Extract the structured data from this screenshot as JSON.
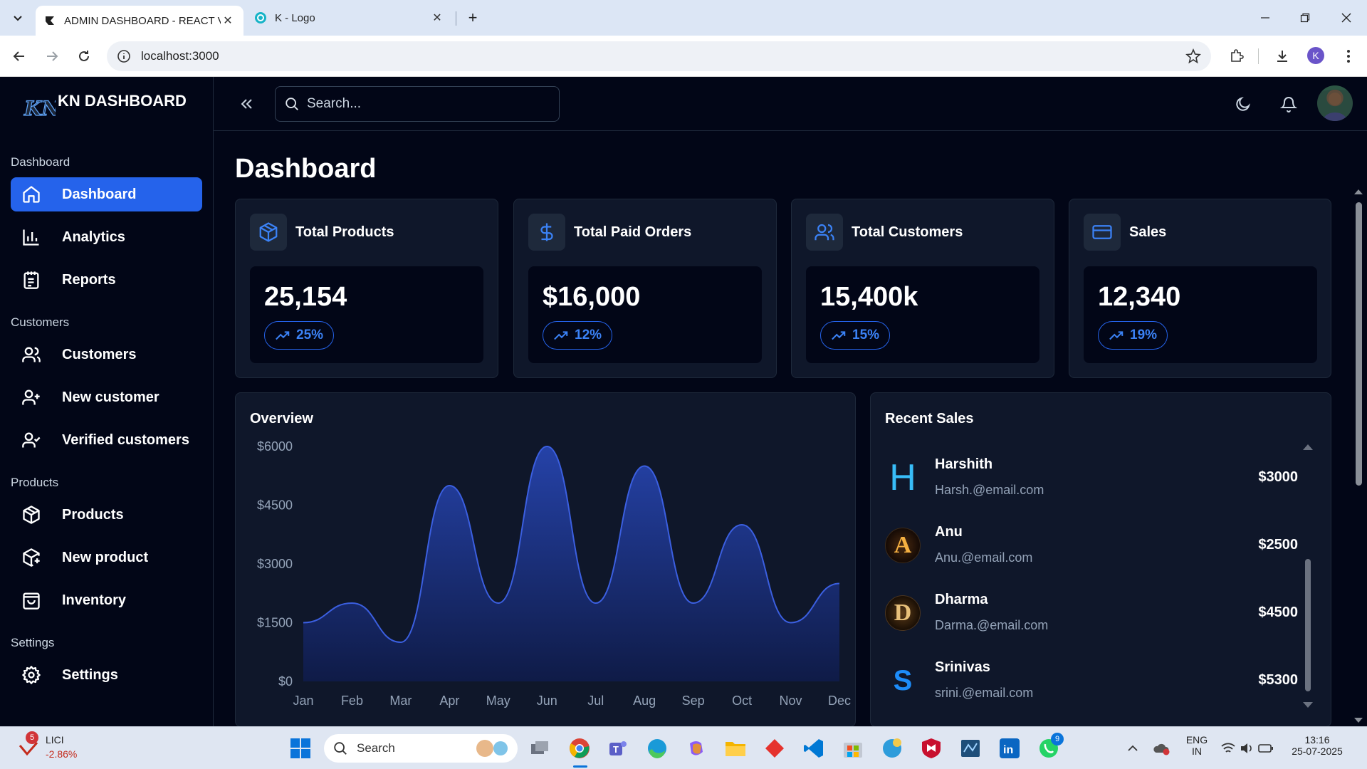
{
  "browser": {
    "tabs": [
      {
        "title": "ADMIN DASHBOARD - REACT V",
        "active": true
      },
      {
        "title": "K - Logo",
        "active": false
      }
    ],
    "new_tab": "+",
    "close": "✕",
    "url": "localhost:3000",
    "profile_initial": "K"
  },
  "app": {
    "brand": "KN DASHBOARD",
    "brand_logo_text": "KN",
    "search_placeholder": "Search...",
    "page_title": "Dashboard"
  },
  "sidebar": {
    "sections": [
      {
        "label": "Dashboard"
      },
      {
        "label": "Customers"
      },
      {
        "label": "Products"
      },
      {
        "label": "Settings"
      }
    ],
    "items": [
      {
        "label": "Dashboard",
        "icon": "home-icon",
        "active": true
      },
      {
        "label": "Analytics",
        "icon": "bar-chart-icon"
      },
      {
        "label": "Reports",
        "icon": "notepad-icon"
      },
      {
        "label": "Customers",
        "icon": "users-icon"
      },
      {
        "label": "New customer",
        "icon": "user-plus-icon"
      },
      {
        "label": "Verified customers",
        "icon": "user-check-icon"
      },
      {
        "label": "Products",
        "icon": "package-icon"
      },
      {
        "label": "New product",
        "icon": "package-plus-icon"
      },
      {
        "label": "Inventory",
        "icon": "shopping-bag-icon"
      },
      {
        "label": "Settings",
        "icon": "gear-icon"
      }
    ]
  },
  "cards": [
    {
      "title": "Total Products",
      "value": "25,154",
      "change": "25%",
      "icon": "package-icon"
    },
    {
      "title": "Total Paid Orders",
      "value": "$16,000",
      "change": "12%",
      "icon": "dollar-icon"
    },
    {
      "title": "Total Customers",
      "value": "15,400k",
      "change": "15%",
      "icon": "users-icon"
    },
    {
      "title": "Sales",
      "value": "12,340",
      "change": "19%",
      "icon": "credit-card-icon"
    }
  ],
  "overview": {
    "title": "Overview"
  },
  "recent_sales": {
    "title": "Recent Sales",
    "rows": [
      {
        "name": "Harshith",
        "email": "Harsh.@email.com",
        "amount": "$3000",
        "avatar_letter": "H"
      },
      {
        "name": "Anu",
        "email": "Anu.@email.com",
        "amount": "$2500",
        "avatar_letter": "A"
      },
      {
        "name": "Dharma",
        "email": "Darma.@email.com",
        "amount": "$4500",
        "avatar_letter": "D"
      },
      {
        "name": "Srinivas",
        "email": "srini.@email.com",
        "amount": "$5300",
        "avatar_letter": "S"
      }
    ]
  },
  "chart_data": {
    "type": "area",
    "title": "Overview",
    "x": [
      "Jan",
      "Feb",
      "Mar",
      "Apr",
      "May",
      "Jun",
      "Jul",
      "Aug",
      "Sep",
      "Oct",
      "Nov",
      "Dec"
    ],
    "y_ticks": [
      "$0",
      "$1500",
      "$3000",
      "$4500",
      "$6000"
    ],
    "ylim": [
      0,
      6000
    ],
    "series": [
      {
        "values": [
          1500,
          2000,
          1000,
          5000,
          2000,
          6000,
          2000,
          5500,
          2000,
          4000,
          1500,
          2500
        ]
      }
    ],
    "colors": {
      "fill_top": "#2542a8",
      "fill_bottom": "#0f1b47",
      "stroke": "#3b5fe0"
    },
    "grid": false
  },
  "taskbar": {
    "stock_name": "LICI",
    "stock_change": "-2.86%",
    "stock_badge": "5",
    "search": "Search",
    "lang_1": "ENG",
    "lang_2": "IN",
    "time": "13:16",
    "date": "25-07-2025",
    "whatsapp_badge": "9"
  }
}
